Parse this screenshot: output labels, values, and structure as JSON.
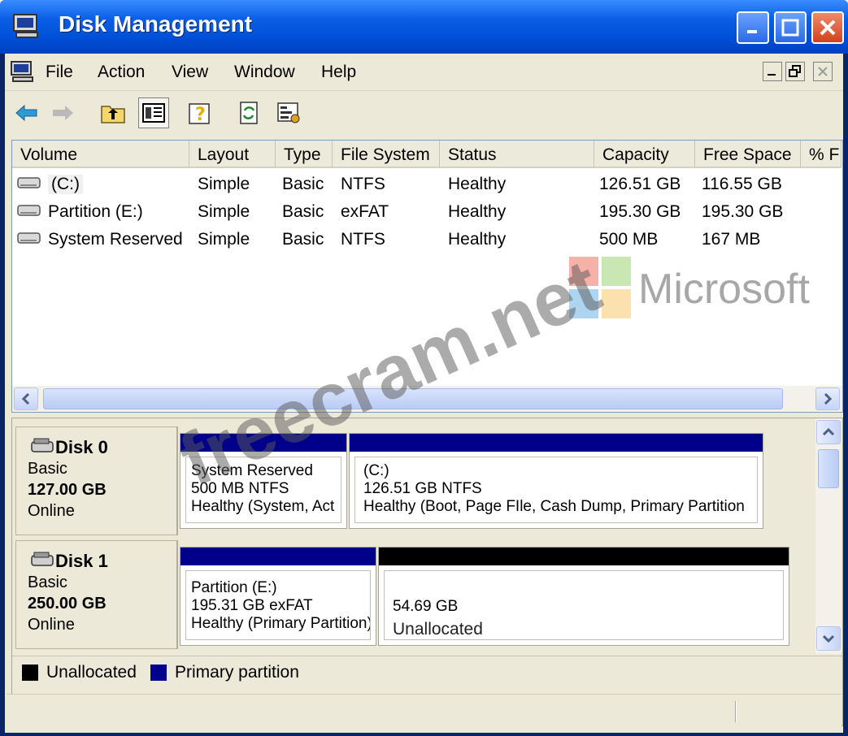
{
  "window": {
    "title": "Disk Management"
  },
  "menubar": {
    "items": [
      {
        "label": "File"
      },
      {
        "label": "Action"
      },
      {
        "label": "View"
      },
      {
        "label": "Window"
      },
      {
        "label": "Help"
      }
    ]
  },
  "toolbar": {
    "buttons": [
      "back-arrow-icon",
      "forward-arrow-icon",
      "up-folder-icon",
      "show-hide-tree-icon",
      "help-icon",
      "refresh-icon",
      "properties-icon"
    ]
  },
  "volume_list": {
    "columns": [
      "Volume",
      "Layout",
      "Type",
      "File System",
      "Status",
      "Capacity",
      "Free Space",
      "% F"
    ],
    "rows": [
      {
        "volume": "(C:)",
        "layout": "Simple",
        "type": "Basic",
        "fs": "NTFS",
        "status": "Healthy",
        "capacity": "126.51 GB",
        "free": "116.55 GB"
      },
      {
        "volume": "Partition (E:)",
        "layout": "Simple",
        "type": "Basic",
        "fs": "exFAT",
        "status": "Healthy",
        "capacity": "195.30 GB",
        "free": "195.30 GB"
      },
      {
        "volume": "System Reserved",
        "layout": "Simple",
        "type": "Basic",
        "fs": "NTFS",
        "status": "Healthy",
        "capacity": "500 MB",
        "free": "167 MB"
      }
    ]
  },
  "disks": [
    {
      "name": "Disk 0",
      "type": "Basic",
      "size": "127.00 GB",
      "state": "Online",
      "partitions": [
        {
          "line1": "System Reserved",
          "line2": "500 MB NTFS",
          "line3": "Healthy (System, Act"
        },
        {
          "line1": "(C:)",
          "line2": "126.51 GB NTFS",
          "line3": "Healthy (Boot, Page FIle, Cash Dump, Primary Partition"
        }
      ]
    },
    {
      "name": "Disk 1",
      "type": "Basic",
      "size": "250.00 GB",
      "state": "Online",
      "partitions": [
        {
          "line1": "Partition (E:)",
          "line2": "195.31 GB exFAT",
          "line3": "Healthy (Primary Partition)"
        },
        {
          "line1": "54.69 GB",
          "line2": "Unallocated",
          "line3": ""
        }
      ]
    }
  ],
  "legend": {
    "unallocated": "Unallocated",
    "primary": "Primary partition"
  },
  "watermark": {
    "site": "freecram.net",
    "brand": "Microsoft"
  },
  "colors": {
    "primary_partition": "#00008b",
    "unallocated": "#000000",
    "title_bar": "#0050d8"
  }
}
